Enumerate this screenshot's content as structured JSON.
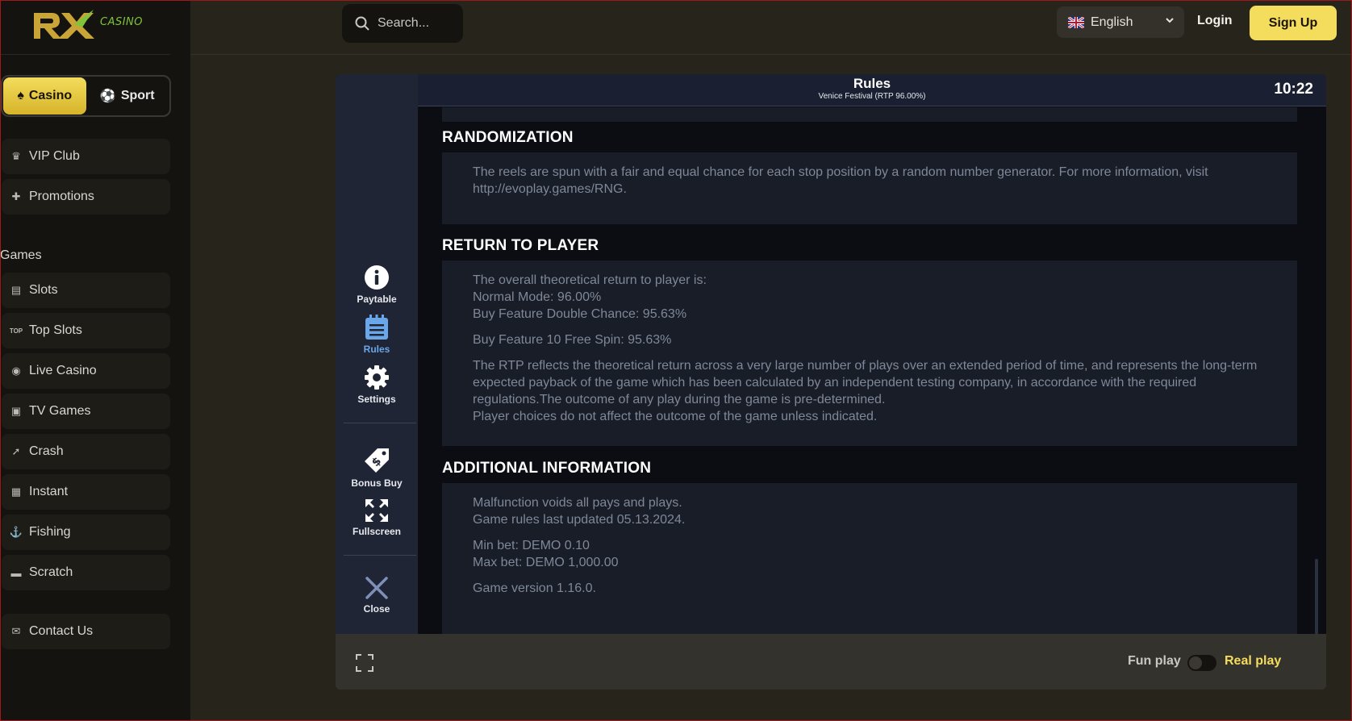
{
  "brand": {
    "logo_text": "RX",
    "logo_sub": "CASINO"
  },
  "colors": {
    "accent": "#f4dc5c",
    "logo_green": "#7fc53a",
    "rules_active": "#6aa6ea"
  },
  "sidebar": {
    "toggle": {
      "casino": "Casino",
      "sport": "Sport"
    },
    "top_items": [
      {
        "label": "VIP Club",
        "icon": "crown-icon"
      },
      {
        "label": "Promotions",
        "icon": "gift-icon"
      }
    ],
    "games_heading": "Games",
    "game_items": [
      {
        "label": "Slots",
        "icon": "slots-icon"
      },
      {
        "label": "Top Slots",
        "icon": "top-icon"
      },
      {
        "label": "Live Casino",
        "icon": "chip-icon"
      },
      {
        "label": "TV Games",
        "icon": "tv-icon"
      },
      {
        "label": "Crash",
        "icon": "rocket-icon"
      },
      {
        "label": "Instant",
        "icon": "grid-icon"
      },
      {
        "label": "Fishing",
        "icon": "fishing-icon"
      },
      {
        "label": "Scratch",
        "icon": "ticket-icon"
      }
    ],
    "contact": {
      "label": "Contact Us",
      "icon": "chat-icon"
    }
  },
  "header": {
    "search_placeholder": "Search...",
    "language": "English",
    "login": "Login",
    "signup": "Sign Up"
  },
  "game": {
    "title": "Rules",
    "subtitle": "Venice Festival (RTP 96.00%)",
    "time": "10:22",
    "tools": [
      {
        "label": "Paytable",
        "icon": "info-icon"
      },
      {
        "label": "Rules",
        "icon": "rules-icon"
      },
      {
        "label": "Settings",
        "icon": "gear-icon"
      },
      {
        "label": "Bonus Buy",
        "icon": "price-tag-icon"
      },
      {
        "label": "Fullscreen",
        "icon": "fullscreen-icon"
      },
      {
        "label": "Close",
        "icon": "close-icon"
      }
    ],
    "sections": {
      "randomization": {
        "heading": "RANDOMIZATION",
        "p1": "The reels are spun with a fair and equal chance for each stop position by a random number generator. For more information, visit http://evoplay.games/RNG."
      },
      "rtp": {
        "heading": "RETURN TO PLAYER",
        "l1": "The overall theoretical return to player is:",
        "l2": "Normal Mode: 96.00%",
        "l3": "Buy Feature Double Chance: 95.63%",
        "l4": "Buy Feature 10 Free Spin: 95.63%",
        "l5": "The RTP reflects the theoretical return across a very large number of plays over an extended period of time, and represents the long-term expected payback of the game which has been calculated by an independent testing company, in accordance with the required regulations.The outcome of any play during the game is pre-determined.",
        "l6": "Player choices do not affect the outcome of the game unless indicated."
      },
      "additional": {
        "heading": "ADDITIONAL INFORMATION",
        "l1": "Malfunction voids all pays and plays.",
        "l2": "Game rules last updated 05.13.2024.",
        "l3": "Min bet: DEMO 0.10",
        "l4": "Max bet: DEMO 1,000.00",
        "l5": "Game version 1.16.0."
      }
    }
  },
  "play_mode": {
    "fun": "Fun play",
    "real": "Real play"
  }
}
